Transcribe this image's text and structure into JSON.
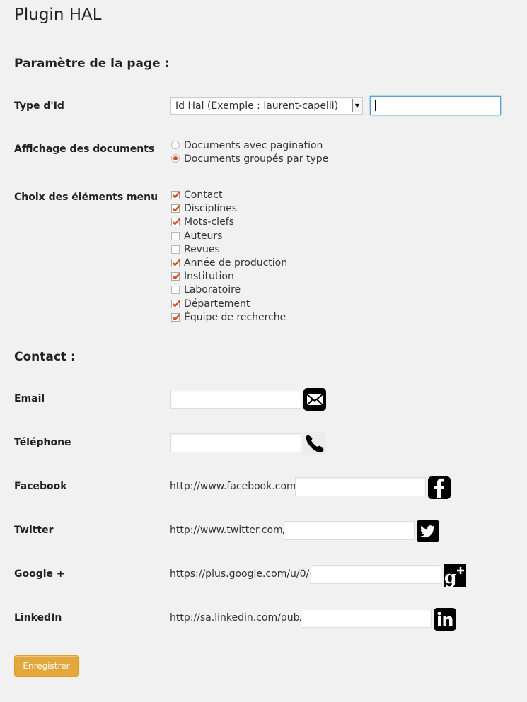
{
  "page": {
    "title": "Plugin HAL"
  },
  "section_page": {
    "heading": "Paramètre de la page :"
  },
  "id_type": {
    "label": "Type d'Id",
    "selected": "Id Hal (Exemple : laurent-capelli)",
    "value": ""
  },
  "display": {
    "label": "Affichage des documents",
    "options": [
      {
        "label": "Documents avec pagination",
        "checked": false
      },
      {
        "label": "Documents groupés par type",
        "checked": true
      }
    ]
  },
  "menu": {
    "label": "Choix des éléments menu",
    "items": [
      {
        "label": "Contact",
        "checked": true
      },
      {
        "label": "Disciplines",
        "checked": true
      },
      {
        "label": "Mots-clefs",
        "checked": true
      },
      {
        "label": "Auteurs",
        "checked": false
      },
      {
        "label": "Revues",
        "checked": false
      },
      {
        "label": "Année de production",
        "checked": true
      },
      {
        "label": "Institution",
        "checked": true
      },
      {
        "label": "Laboratoire",
        "checked": false
      },
      {
        "label": "Département",
        "checked": true
      },
      {
        "label": "Équipe de recherche",
        "checked": true
      }
    ]
  },
  "contact": {
    "heading": "Contact :",
    "email": {
      "label": "Email",
      "value": "",
      "icon": "envelope-icon"
    },
    "phone": {
      "label": "Téléphone",
      "value": "",
      "icon": "phone-icon"
    },
    "facebook": {
      "label": "Facebook",
      "prefix": "http://www.facebook.com/",
      "value": "",
      "icon": "facebook-icon"
    },
    "twitter": {
      "label": "Twitter",
      "prefix": "http://www.twitter.com/",
      "value": "",
      "icon": "twitter-icon"
    },
    "google": {
      "label": "Google +",
      "prefix": "https://plus.google.com/u/0/+",
      "value": "",
      "icon": "google-plus-icon"
    },
    "linkedin": {
      "label": "LinkedIn",
      "prefix": "http://sa.linkedin.com/pub/",
      "value": "",
      "icon": "linkedin-icon"
    }
  },
  "submit": {
    "label": "Enregistrer",
    "color": "#e3a73c"
  },
  "colors": {
    "checkbox_mark": "#d54e21",
    "focus": "#5b9dd9"
  }
}
